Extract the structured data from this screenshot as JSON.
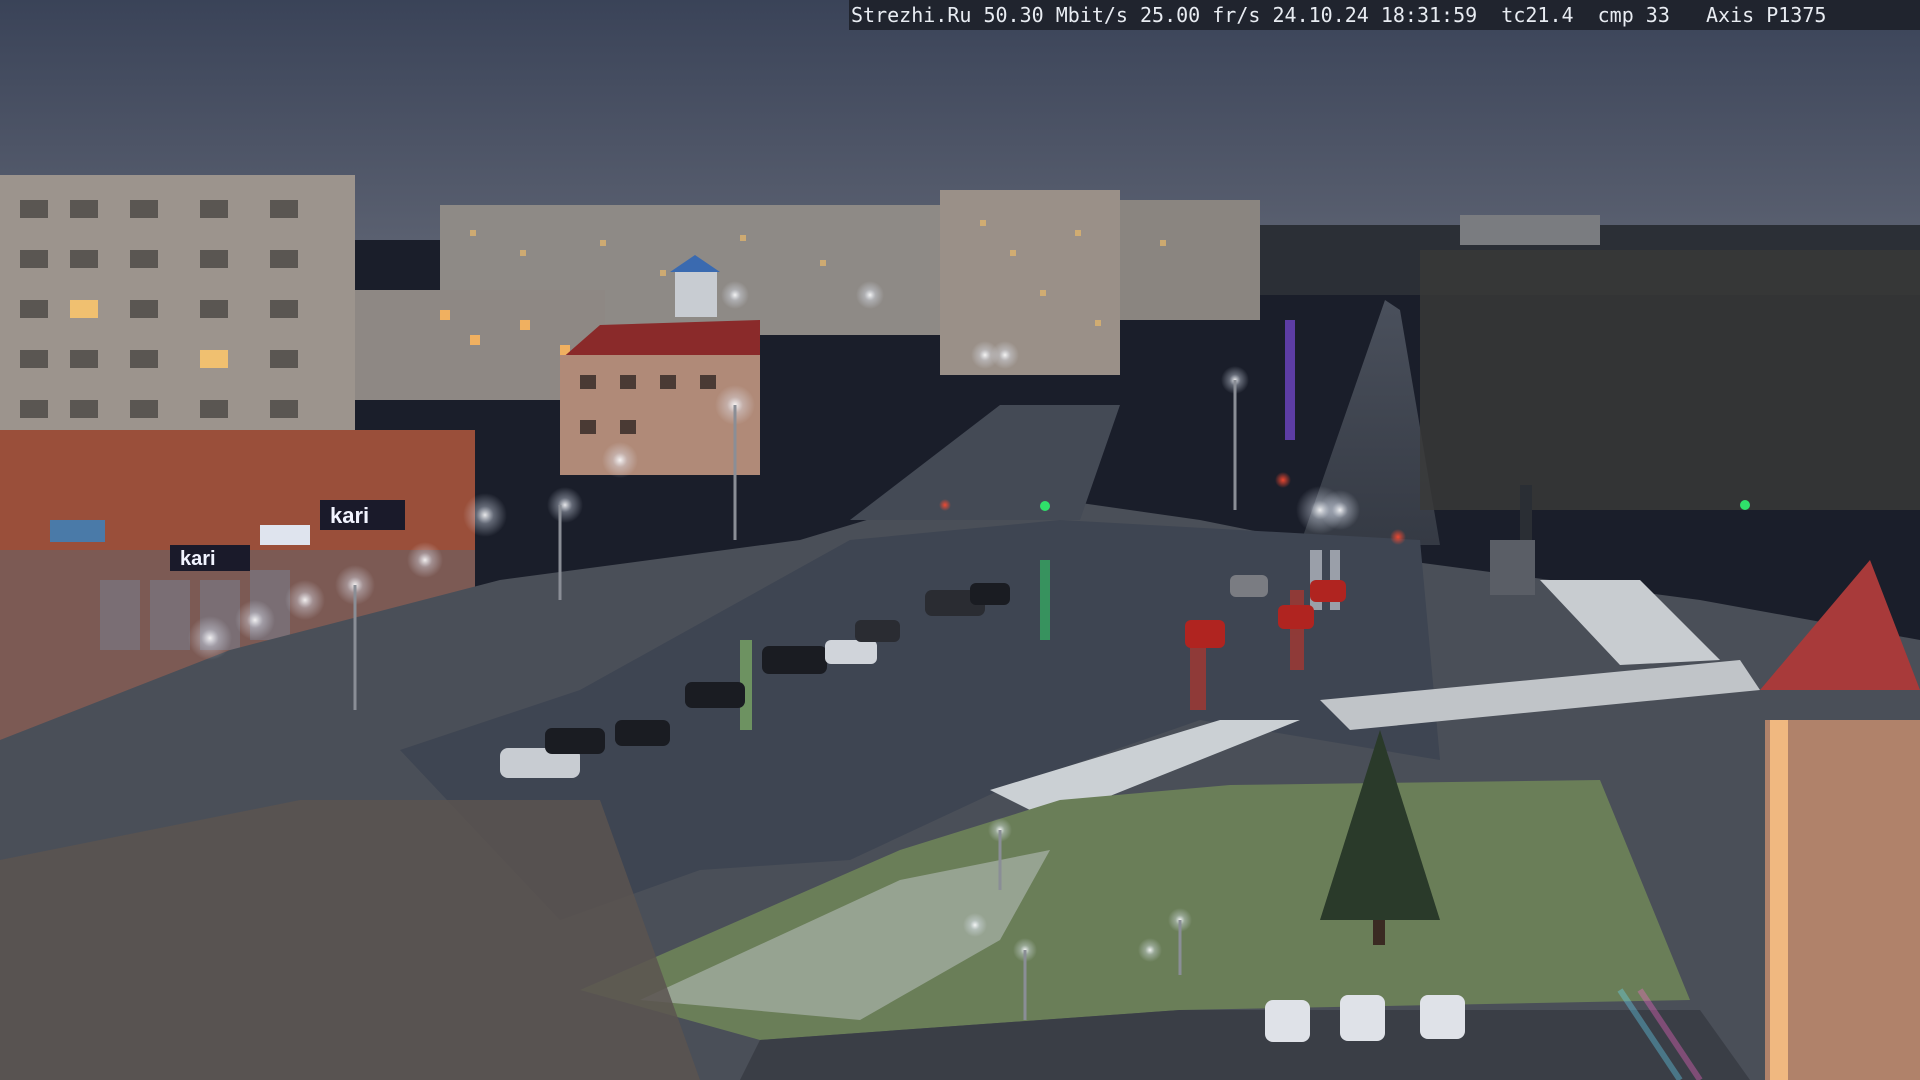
{
  "overlay": {
    "site": "Strezhi.Ru",
    "bitrate": "50.30 Mbit/s",
    "framerate": "25.00 fr/s",
    "timestamp": "24.10.24 18:31:59",
    "temperature": "tc21.4",
    "compression": "cmp 33",
    "camera_model": "Axis P1375"
  },
  "signage": {
    "store_sign_1": "kari",
    "store_sign_2": "kari"
  },
  "colors": {
    "sky": "#3a4358",
    "road": "#3e4552",
    "lamp": "#f5f8ff",
    "tail_light": "#e0301e",
    "green_signal": "#2fe06a"
  }
}
